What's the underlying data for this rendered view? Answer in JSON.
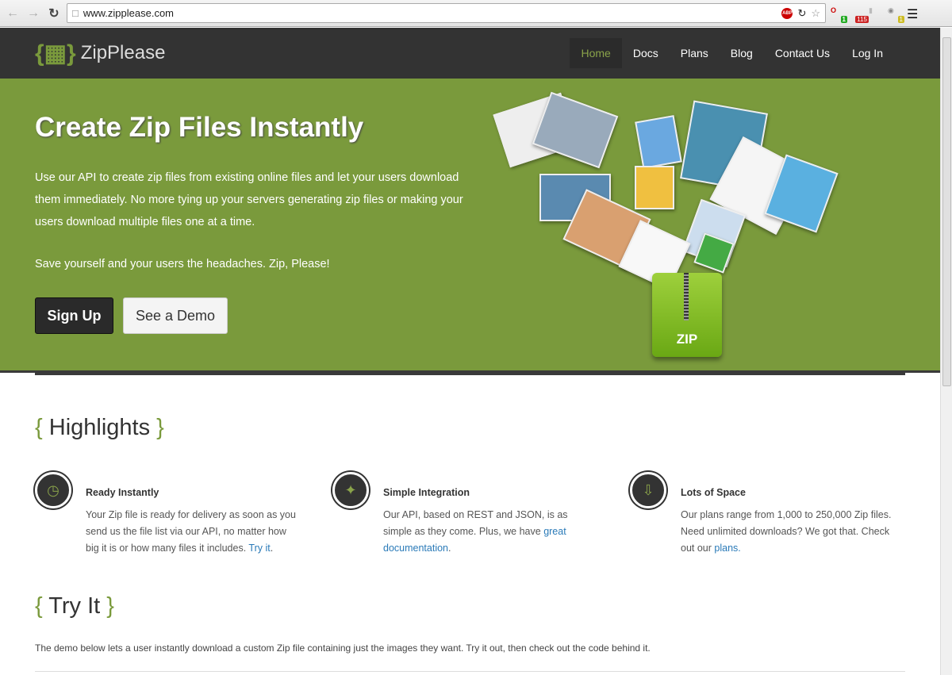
{
  "browser": {
    "url": "www.zipplease.com",
    "ext_badge": "115"
  },
  "nav": {
    "logo": "ZipPlease",
    "items": [
      "Home",
      "Docs",
      "Plans",
      "Blog",
      "Contact Us",
      "Log In"
    ]
  },
  "hero": {
    "title": "Create Zip Files Instantly",
    "p1": "Use our API to create zip files from existing online files and let your users download them immediately. No more tying up your servers generating zip files or making your users download multiple files one at a time.",
    "p2": "Save yourself and your users the headaches. Zip, Please!",
    "signup": "Sign Up",
    "demo": "See a Demo",
    "zip_label": "ZIP"
  },
  "highlights": {
    "open": "{",
    "close": "}",
    "title": "Highlights",
    "items": [
      {
        "title": "Ready Instantly",
        "text": "Your Zip file is ready for delivery as soon as you send us the file list via our API, no matter how big it is or how many files it includes. ",
        "link": "Try it",
        "after": "."
      },
      {
        "title": "Simple Integration",
        "text": "Our API, based on REST and JSON, is as simple as they come. Plus, we have ",
        "link": "great documentation",
        "after": "."
      },
      {
        "title": "Lots of Space",
        "text": "Our plans range from 1,000 to 250,000 Zip files. Need unlimited downloads? We got that. Check out our ",
        "link": "plans.",
        "after": ""
      }
    ]
  },
  "tryit": {
    "title": "Try It",
    "intro": "The demo below lets a user instantly download a custom Zip file containing just the images they want. Try it out, then check out the code behind it."
  }
}
